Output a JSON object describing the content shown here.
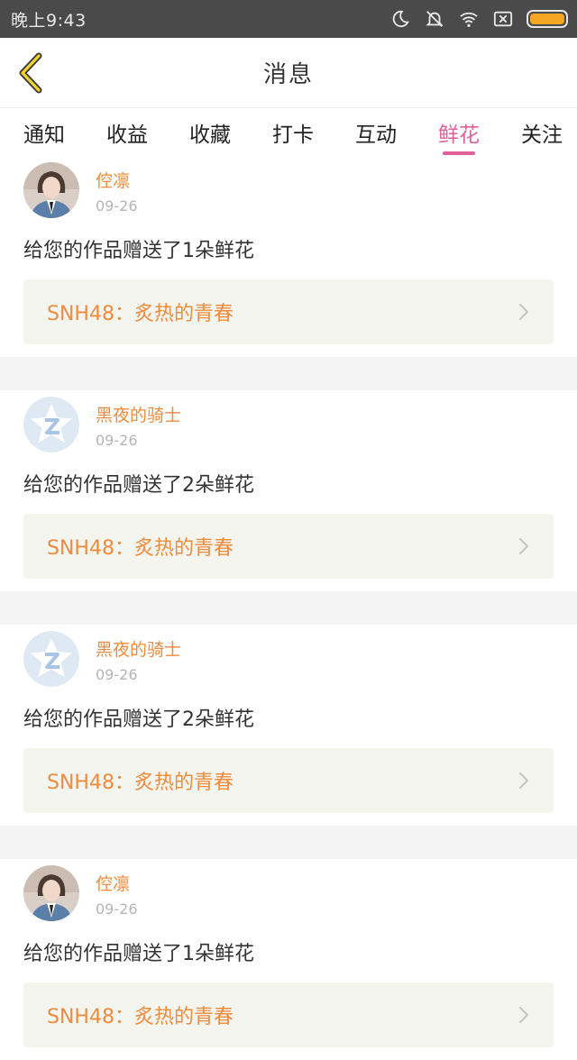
{
  "status_bar": {
    "time": "晚上9:43",
    "icons": [
      "moon-icon",
      "mute-icon",
      "wifi-icon",
      "sim-icon",
      "battery-icon"
    ],
    "battery_color": "#f5a623"
  },
  "header": {
    "back_icon": "chevron-left-icon",
    "title": "消息"
  },
  "tabs": [
    {
      "label": "通知",
      "active": false
    },
    {
      "label": "收益",
      "active": false
    },
    {
      "label": "收藏",
      "active": false
    },
    {
      "label": "打卡",
      "active": false
    },
    {
      "label": "互动",
      "active": false
    },
    {
      "label": "鲜花",
      "active": true
    },
    {
      "label": "关注",
      "active": false
    }
  ],
  "colors": {
    "accent": "#e0609a",
    "name": "#f08a3c",
    "date": "#b5b5b5"
  },
  "messages": [
    {
      "avatar": "user-photo",
      "name": "倥凛",
      "date": "09-26",
      "text": "给您的作品赠送了1朵鲜花",
      "work": "SNH48：炙热的青春"
    },
    {
      "avatar": "default-star-avatar",
      "name": "黑夜的骑士",
      "date": "09-26",
      "text": "给您的作品赠送了2朵鲜花",
      "work": "SNH48：炙热的青春"
    },
    {
      "avatar": "default-star-avatar",
      "name": "黑夜的骑士",
      "date": "09-26",
      "text": "给您的作品赠送了2朵鲜花",
      "work": "SNH48：炙热的青春"
    },
    {
      "avatar": "user-photo",
      "name": "倥凛",
      "date": "09-26",
      "text": "给您的作品赠送了1朵鲜花",
      "work": "SNH48：炙热的青春"
    }
  ]
}
